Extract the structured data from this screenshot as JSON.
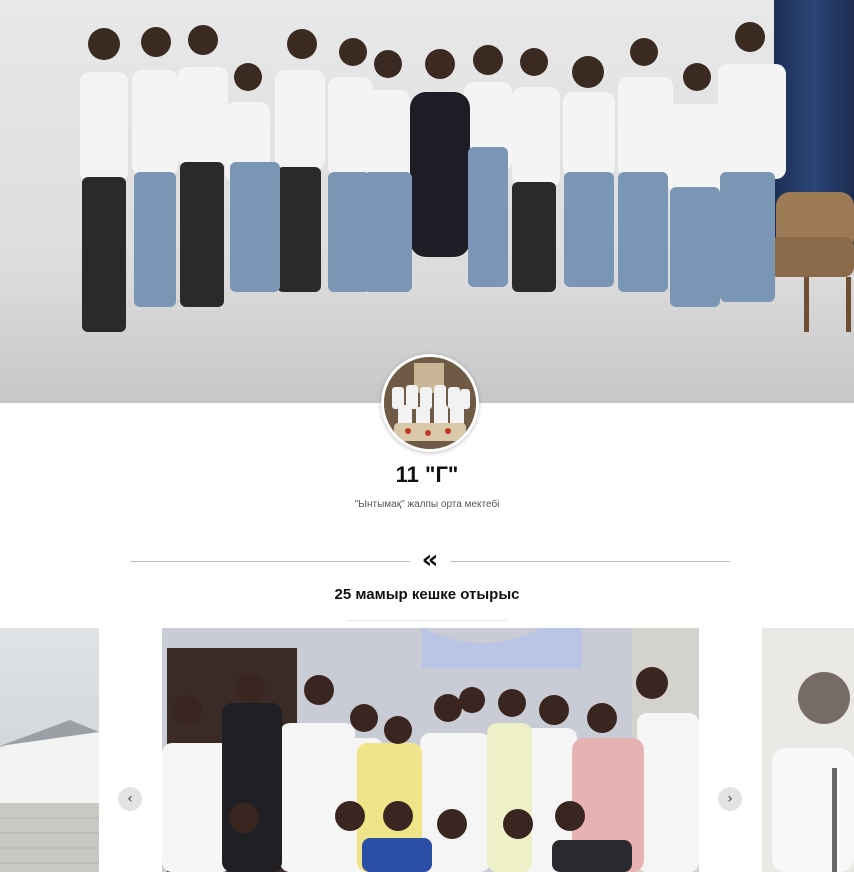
{
  "header": {
    "cover_alt": "class group photo",
    "avatar_alt": "group avatar"
  },
  "profile": {
    "title": "11 \"Г\"",
    "subtitle": "\"Ынтымақ\" жалпы орта мектебі"
  },
  "section": {
    "divider_icon": "«",
    "title": "25 мамыр кешке отырыс"
  },
  "carousel": {
    "prev_icon": "‹",
    "next_icon": "›"
  },
  "colors": {
    "accent": "#111111",
    "divider": "#bdbdbd",
    "arrow_bg": "#e3e3e3"
  }
}
